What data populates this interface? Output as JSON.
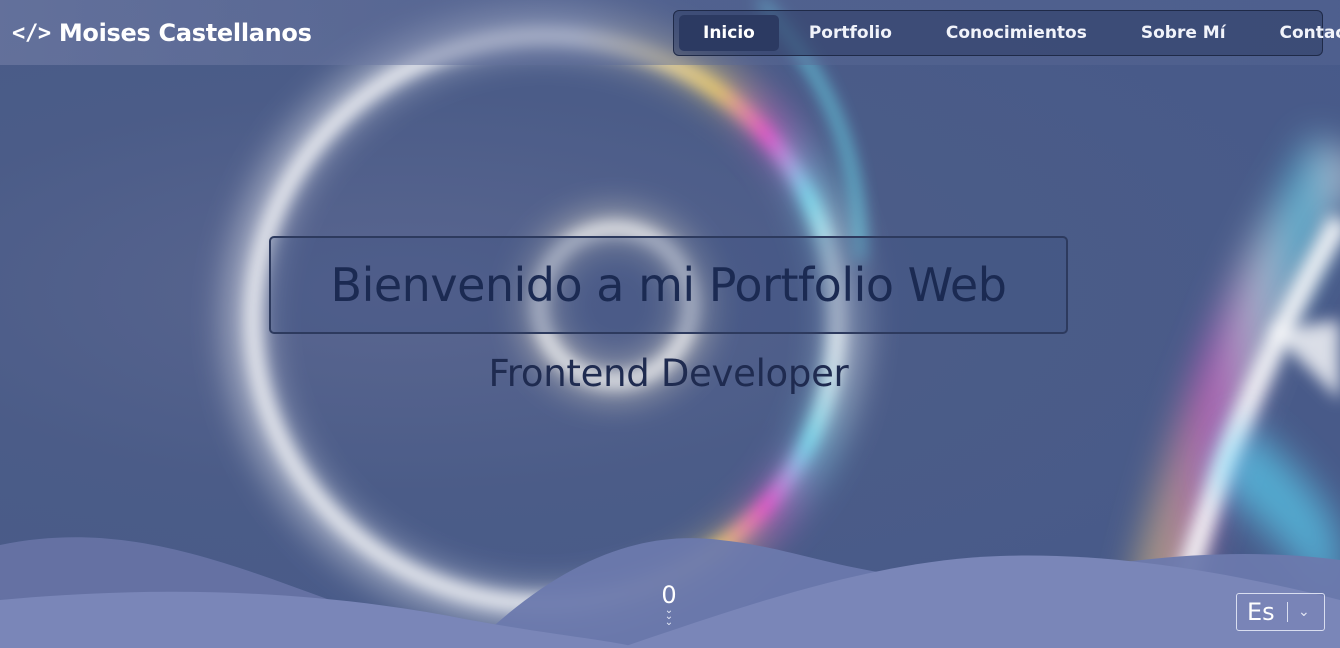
{
  "brand": {
    "icon": "code-icon",
    "icon_glyph": "</>",
    "name": "Moises Castellanos"
  },
  "nav": {
    "items": [
      {
        "label": "Inicio",
        "active": true
      },
      {
        "label": "Portfolio",
        "active": false
      },
      {
        "label": "Conocimientos",
        "active": false
      },
      {
        "label": "Sobre Mí",
        "active": false
      },
      {
        "label": "Contacto",
        "active": false
      }
    ]
  },
  "hero": {
    "title": "Bienvenido a mi Portfolio Web",
    "subtitle": "Frontend Developer"
  },
  "scroll": {
    "counter": "0",
    "icon": "chevrons-down-icon"
  },
  "language": {
    "value": "Es",
    "icon": "chevron-down-icon"
  },
  "colors": {
    "background": "#4a5b86",
    "wave": "#7a86b8",
    "title_text": "#1b2a52",
    "nav_active": "#2c3a62"
  }
}
